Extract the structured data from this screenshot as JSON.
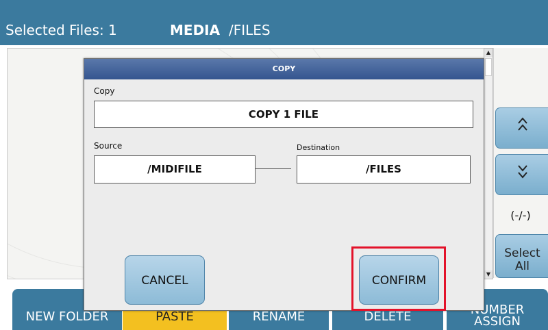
{
  "header": {
    "selected_files": "Selected Files:  1",
    "media": "MEDIA",
    "path": "/FILES"
  },
  "sidebar": {
    "up_glyph": "^",
    "down_glyph": "v",
    "counter": "(-/-)",
    "select_all_line1": "Select",
    "select_all_line2": "All"
  },
  "bottom_buttons": {
    "new_folder": "NEW FOLDER",
    "paste": "PASTE",
    "rename": "RENAME",
    "delete": "DELETE",
    "number_assign_line1": "NUMBER",
    "number_assign_line2": "ASSIGN"
  },
  "dialog": {
    "title": "COPY",
    "copy_label": "Copy",
    "copy_value": "COPY 1 FILE",
    "source_label": "Source",
    "source_value": "/MIDIFILE",
    "destination_label": "Destination",
    "destination_value": "/FILES",
    "cancel_label": "CANCEL",
    "confirm_label": "CONFIRM"
  },
  "colors": {
    "header_bg": "#3b7a9e",
    "paste_bg": "#f3c020",
    "highlight": "#e3122a"
  },
  "icons": [
    "scroll-up-arrow-icon",
    "scroll-down-arrow-icon",
    "chevron-up-icon",
    "chevron-down-icon"
  ]
}
